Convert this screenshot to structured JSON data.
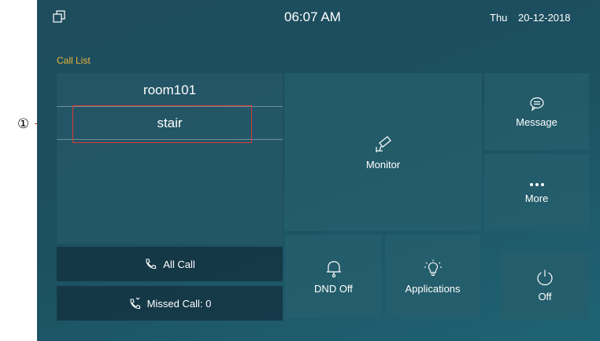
{
  "status_bar": {
    "time": "06:07 AM",
    "day": "Thu",
    "date": "20-12-2018"
  },
  "call_list": {
    "label": "Call List",
    "items": [
      "room101",
      "stair"
    ]
  },
  "buttons": {
    "all_call": "All Call",
    "missed_call": "Missed Call: 0"
  },
  "tiles": {
    "monitor": "Monitor",
    "message": "Message",
    "more": "More",
    "dnd": "DND Off",
    "applications": "Applications",
    "off": "Off"
  },
  "annotation": {
    "marker": "①"
  },
  "icons": {
    "window": "window-toggle-icon",
    "phone": "phone-icon",
    "missed_phone": "missed-call-icon",
    "camera": "camera-icon",
    "message": "chat-bubble-icon",
    "more": "ellipsis-icon",
    "dnd": "bell-icon",
    "applications": "lightbulb-icon",
    "power": "power-icon"
  },
  "colors": {
    "accent": "#e8b23a",
    "annotation": "#d93a3a"
  }
}
